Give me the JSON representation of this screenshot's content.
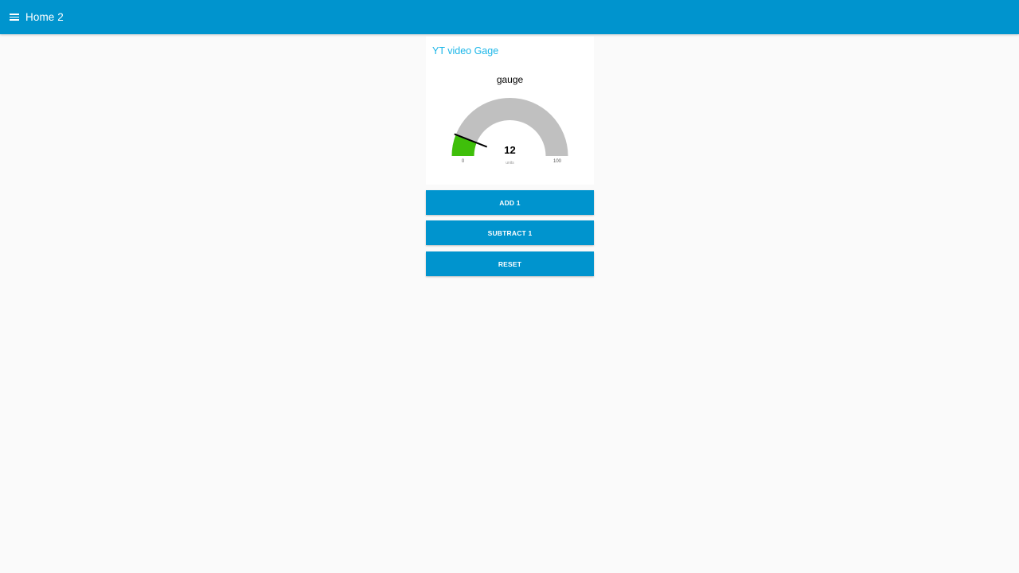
{
  "header": {
    "title": "Home 2",
    "menu_icon": "hamburger-menu-icon",
    "color": "#0094ce"
  },
  "group": {
    "title": "YT video Gage",
    "title_color": "#1bb6e8"
  },
  "gauge": {
    "label": "gauge",
    "value": 12,
    "value_text": "12",
    "units": "units",
    "min": 0,
    "max": 100,
    "min_text": "0",
    "max_text": "100",
    "fill_color": "#3fbf0a",
    "track_color": "#c0c0c0",
    "needle_color": "#000000"
  },
  "buttons": {
    "add": "ADD 1",
    "subtract": "SUBTRACT 1",
    "reset": "RESET"
  }
}
